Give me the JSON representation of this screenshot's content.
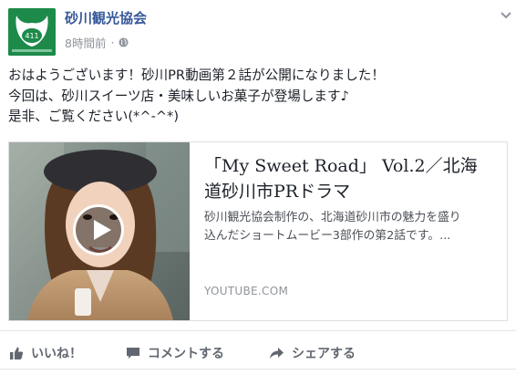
{
  "page": {
    "name": "砂川観光協会",
    "timestamp": "8時間前",
    "meta_separator": "·",
    "privacy_icon": "globe-icon",
    "menu_icon": "chevron-down-icon"
  },
  "post": {
    "lines": [
      "おはようございます！砂川PR動画第２話が公開になりました！",
      "今回は、砂川スイーツ店・美味しいお菓子が登場します♪",
      "是非、ご覧ください(*^-^*)"
    ]
  },
  "link_card": {
    "title_lines": [
      "「My Sweet Road」 Vol.2／北海",
      "道砂川市PRドラマ"
    ],
    "description_lines": [
      "砂川観光協会制作の、北海道砂川市の魅力を盛り",
      "込んだショートムービー3部作の第2話です。..."
    ],
    "domain": "YOUTUBE.COM",
    "thumbnail_icon": "play-icon"
  },
  "actions": {
    "like": "いいね！",
    "comment": "コメントする",
    "share": "シェアする"
  },
  "colors": {
    "link_blue": "#365899",
    "meta_gray": "#90949c",
    "action_gray": "#616770",
    "avatar_green": "#1d8a4a"
  }
}
